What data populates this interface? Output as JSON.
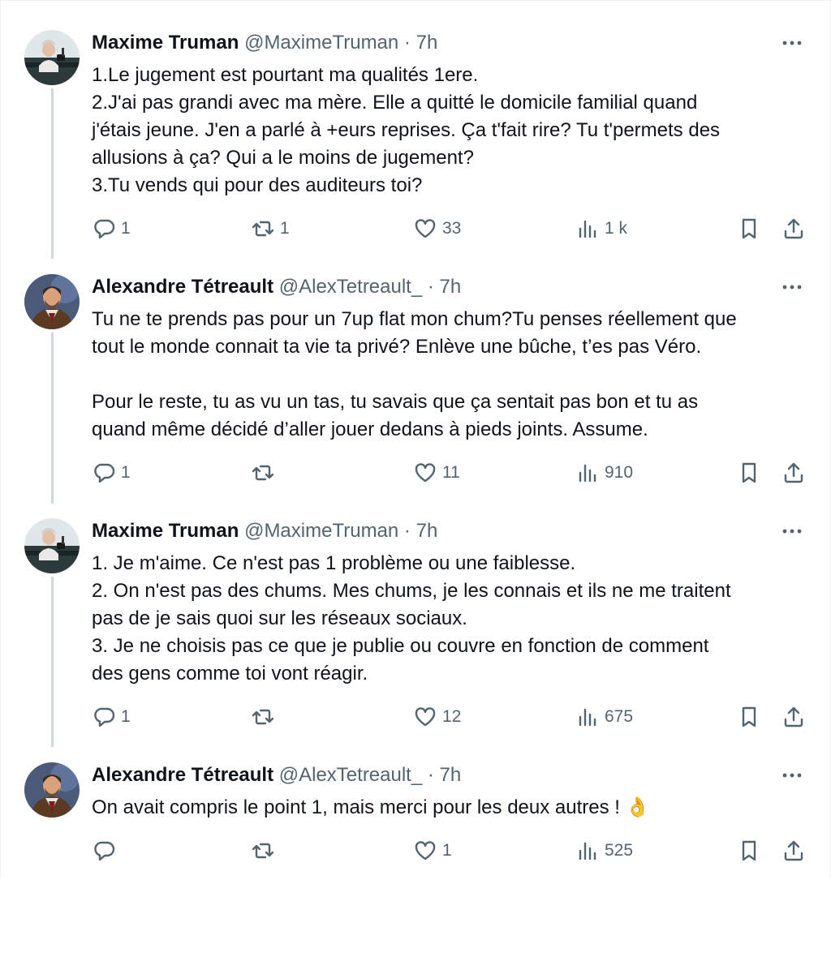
{
  "tweets": [
    {
      "author": "maxime",
      "name": "Maxime Truman",
      "handle": "@MaximeTruman",
      "separator": "·",
      "time": "7h",
      "lines": [
        "1.Le jugement est pourtant ma qualités 1ere.",
        "2.J'ai pas grandi avec ma mère. Elle a quitté le domicile familial quand",
        "j'étais jeune. J'en a parlé à +eurs reprises. Ça t'fait rire? Tu t'permets des",
        "allusions à ça? Qui a le moins de jugement?",
        "3.Tu vends qui pour des auditeurs toi?"
      ],
      "replies": "1",
      "reposts": "1",
      "likes": "33",
      "views": "1 k"
    },
    {
      "author": "alexandre",
      "name": "Alexandre Tétreault",
      "handle": "@AlexTetreault_",
      "separator": "·",
      "time": "7h",
      "lines": [
        "Tu ne te prends pas pour un 7up flat mon chum?Tu penses réellement que",
        "tout le monde connait ta vie ta privé? Enlève une bûche, t’es pas Véro.",
        "",
        "Pour le reste, tu as vu un tas, tu savais que ça sentait pas bon et tu as",
        "quand même décidé d’aller jouer dedans à pieds joints. Assume."
      ],
      "replies": "1",
      "reposts": "",
      "likes": "11",
      "views": "910"
    },
    {
      "author": "maxime",
      "name": "Maxime Truman",
      "handle": "@MaximeTruman",
      "separator": "·",
      "time": "7h",
      "lines": [
        "1. Je m'aime. Ce n'est pas 1 problème ou une faiblesse.",
        "2. On n'est pas des chums. Mes chums, je les connais et ils ne me traitent",
        "pas de je sais quoi sur les réseaux sociaux.",
        "3. Je ne choisis pas ce que je publie ou couvre en fonction de comment",
        "des gens comme toi vont réagir."
      ],
      "replies": "1",
      "reposts": "",
      "likes": "12",
      "views": "675"
    },
    {
      "author": "alexandre",
      "name": "Alexandre Tétreault",
      "handle": "@AlexTetreault_",
      "separator": "·",
      "time": "7h",
      "lines": [
        "On avait compris le point 1, mais merci pour les deux autres ! 👌"
      ],
      "replies": "",
      "reposts": "",
      "likes": "1",
      "views": "525"
    }
  ],
  "icons": {
    "more": "more-icon",
    "reply": "reply-icon",
    "repost": "repost-icon",
    "like": "like-icon",
    "views": "views-icon",
    "bookmark": "bookmark-icon",
    "share": "share-icon"
  },
  "colors": {
    "text": "#0f1419",
    "secondary": "#536471",
    "thread_line": "#cfd9de"
  }
}
